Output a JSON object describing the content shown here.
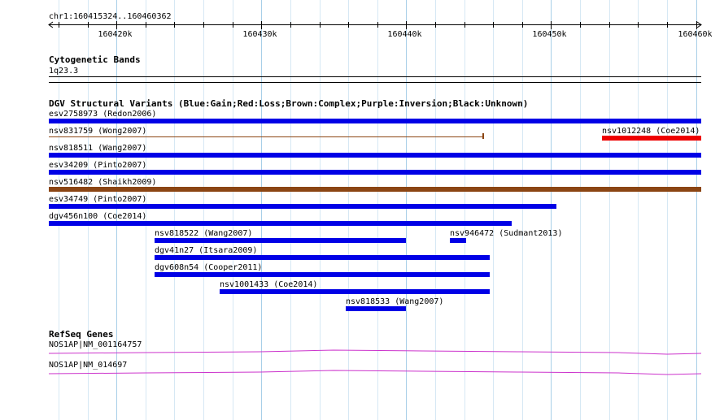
{
  "region": "chr1:160415324..160460362",
  "ruler": {
    "start": 160415324,
    "end": 160460362,
    "ticks": [
      {
        "pos": 160420000,
        "label": "160420k"
      },
      {
        "pos": 160430000,
        "label": "160430k"
      },
      {
        "pos": 160440000,
        "label": "160440k"
      },
      {
        "pos": 160450000,
        "label": "160450k"
      },
      {
        "pos": 160460000,
        "label": "160460k"
      }
    ]
  },
  "cytobands": {
    "title": "Cytogenetic Bands",
    "band": "1q23.3"
  },
  "dgv": {
    "title": "DGV Structural Variants (Blue:Gain;Red:Loss;Brown:Complex;Purple:Inversion;Black:Unknown)",
    "colors": {
      "gain": "#0000e6",
      "loss": "#ee0000",
      "complex": "#8b4513",
      "unknown_line": "#8b4513"
    },
    "features": [
      {
        "label": "esv2758973 (Redon2006)",
        "start": 160415324,
        "end": 160460362,
        "type": "gain",
        "row": 0
      },
      {
        "label": "nsv831759 (Wong2007)",
        "start": 160415324,
        "end": 160445290,
        "type": "unknown_line",
        "row": 1
      },
      {
        "label": "nsv1012248 (Coe2014)",
        "start": 160453500,
        "end": 160460362,
        "type": "loss",
        "row": 1
      },
      {
        "label": "nsv818511 (Wang2007)",
        "start": 160415324,
        "end": 160460362,
        "type": "gain",
        "row": 2
      },
      {
        "label": "esv34209 (Pinto2007)",
        "start": 160415324,
        "end": 160460362,
        "type": "gain",
        "row": 3
      },
      {
        "label": "nsv516482 (Shaikh2009)",
        "start": 160415324,
        "end": 160460362,
        "type": "complex",
        "row": 4
      },
      {
        "label": "esv34749 (Pinto2007)",
        "start": 160415324,
        "end": 160450370,
        "type": "gain",
        "row": 5
      },
      {
        "label": "dgv456n100 (Coe2014)",
        "start": 160415324,
        "end": 160447250,
        "type": "gain",
        "row": 6
      },
      {
        "label": "nsv818522 (Wang2007)",
        "start": 160422600,
        "end": 160440000,
        "type": "gain",
        "row": 7
      },
      {
        "label": "nsv946472 (Sudmant2013)",
        "start": 160443000,
        "end": 160444150,
        "type": "gain",
        "row": 7
      },
      {
        "label": "dgv41n27 (Itsara2009)",
        "start": 160422600,
        "end": 160445750,
        "type": "gain",
        "row": 8
      },
      {
        "label": "dgv608n54 (Cooper2011)",
        "start": 160422600,
        "end": 160445750,
        "type": "gain",
        "row": 9
      },
      {
        "label": "nsv1001433 (Coe2014)",
        "start": 160427100,
        "end": 160445750,
        "type": "gain",
        "row": 10
      },
      {
        "label": "nsv818533 (Wang2007)",
        "start": 160435800,
        "end": 160440000,
        "type": "gain",
        "row": 11
      }
    ]
  },
  "refseq": {
    "title": "RefSeq Genes",
    "color": "#cc33cc",
    "genes": [
      {
        "label": "NOS1AP|NM_001164757",
        "row": 0
      },
      {
        "label": "NOS1AP|NM_014697",
        "row": 1
      }
    ]
  }
}
